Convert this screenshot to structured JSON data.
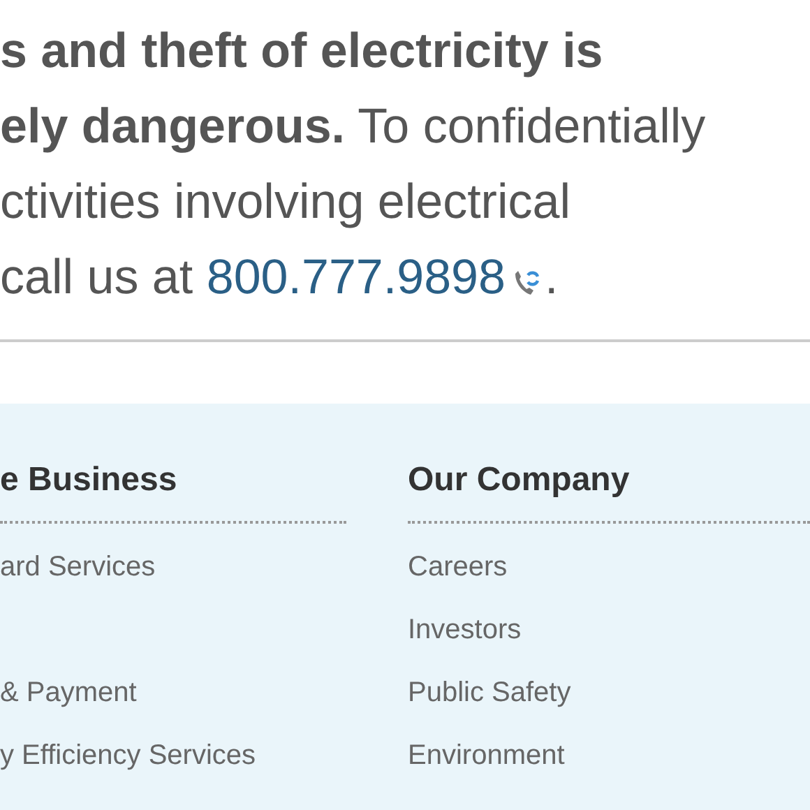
{
  "notice": {
    "lines": [
      "**s and theft of electricity is**",
      "**ely dangerous.** To confidentially",
      "ctivities involving electrical",
      "call us at "
    ],
    "phone": "800.777.9898",
    "end": "."
  },
  "footer": {
    "columns": [
      {
        "heading": "e Business",
        "links": [
          {
            "label": "ard Services"
          },
          {
            "label": "& Payment",
            "gap_before": true
          },
          {
            "label": "y Efficiency Services"
          }
        ]
      },
      {
        "heading": "Our Company",
        "links": [
          {
            "label": "Careers"
          },
          {
            "label": "Investors"
          },
          {
            "label": "Public Safety"
          },
          {
            "label": "Environment"
          }
        ]
      }
    ]
  }
}
